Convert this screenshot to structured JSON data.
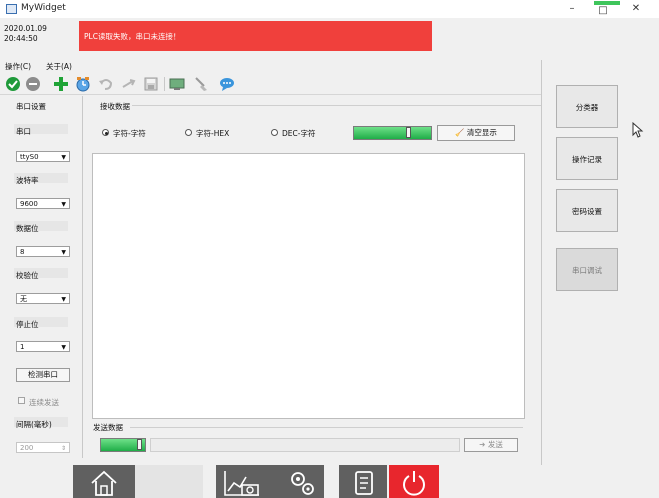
{
  "window": {
    "title": "MyWidget",
    "min": "–",
    "max": "□",
    "close": "✕"
  },
  "header": {
    "date": "2020.01.09",
    "time": "20:44:50",
    "alert": "PLC读取失败，串口未连接！",
    "alert_color": "#f0403c"
  },
  "menu": {
    "items": [
      {
        "label": "操作(C)"
      },
      {
        "label": "关于(A)"
      }
    ]
  },
  "toolbar": {
    "icons": [
      "check-icon",
      "minus-circle-icon",
      "plus-icon",
      "timer-icon",
      "undo-icon",
      "redo-icon",
      "save-icon",
      "monitor-icon",
      "broom-icon",
      "chat-icon"
    ]
  },
  "serial": {
    "group_title": "串口设置",
    "port_label": "串口",
    "port_value": "ttyS0",
    "baud_label": "波特率",
    "baud_value": "9600",
    "data_bits_label": "数据位",
    "data_bits_value": "8",
    "parity_label": "校验位",
    "parity_value": "无",
    "stop_bits_label": "停止位",
    "stop_bits_value": "1",
    "detect_button": "检测串口",
    "continuous_label": "连续发送",
    "interval_label": "间隔(毫秒)",
    "interval_value": "200"
  },
  "receive": {
    "group_title": "接收数据",
    "modes": [
      {
        "label": "字符-字符",
        "selected": true
      },
      {
        "label": "字符-HEX",
        "selected": false
      },
      {
        "label": "DEC-字符",
        "selected": false
      }
    ],
    "clear_button": "清空显示",
    "content": ""
  },
  "send": {
    "group_title": "发送数据",
    "input_value": "",
    "send_button": "发送"
  },
  "side_buttons": [
    {
      "label": "分类器",
      "enabled": true
    },
    {
      "label": "操作记录",
      "enabled": true
    },
    {
      "label": "密码设置",
      "enabled": true
    },
    {
      "label": "串口调试",
      "enabled": false
    }
  ],
  "bottom_nav": [
    {
      "icon": "home-icon"
    },
    {
      "icon": "blank-icon"
    },
    {
      "icon": "chart-camera-icon"
    },
    {
      "icon": "gears-icon"
    },
    {
      "icon": "document-icon"
    },
    {
      "icon": "power-icon"
    }
  ],
  "colors": {
    "active_nav": "#e8262d",
    "nav_bg": "#606060",
    "progress": "#2fbf55"
  }
}
